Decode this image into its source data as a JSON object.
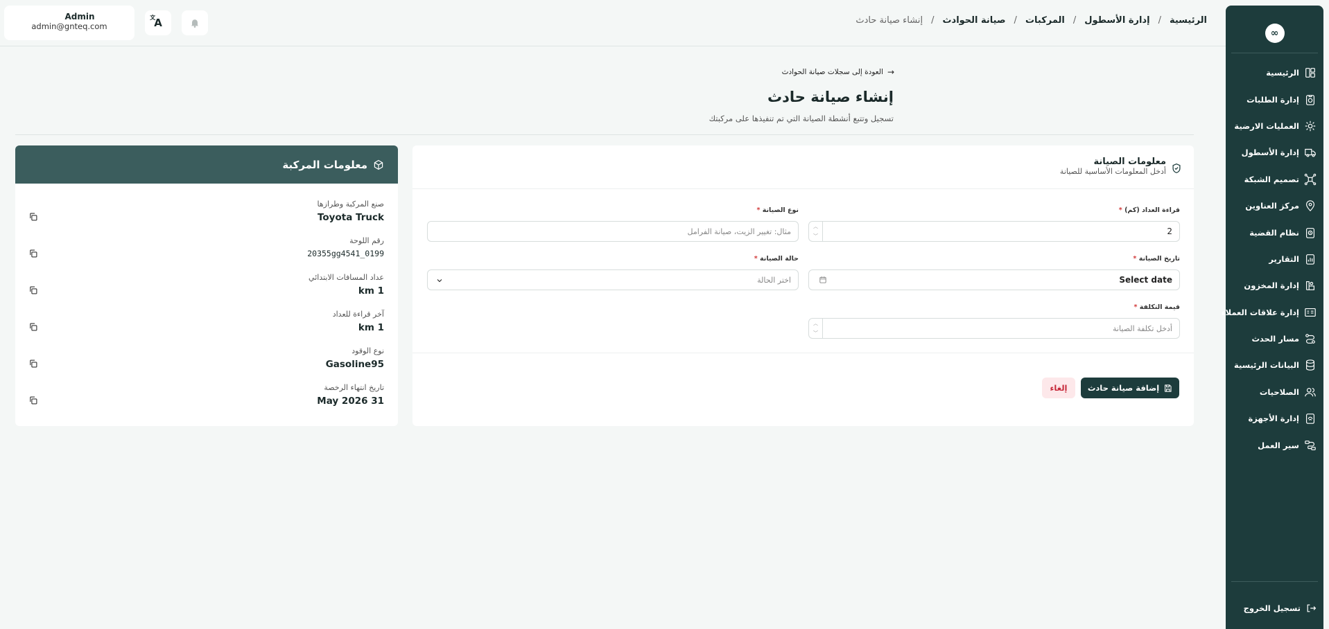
{
  "sidebar": {
    "logo": "∞",
    "items": [
      {
        "label": "الرئيسية",
        "icon": "dashboard-icon"
      },
      {
        "label": "إدارة الطلبات",
        "icon": "orders-icon"
      },
      {
        "label": "العمليات الارضية",
        "icon": "ground-ops-icon"
      },
      {
        "label": "إدارة الأسطول",
        "icon": "truck-icon"
      },
      {
        "label": "تصميم الشبكة",
        "icon": "network-icon"
      },
      {
        "label": "مركز العناوين",
        "icon": "location-pin-icon"
      },
      {
        "label": "نظام القضية",
        "icon": "case-icon"
      },
      {
        "label": "التقارير",
        "icon": "report-icon"
      },
      {
        "label": "إدارة المخزون",
        "icon": "inventory-icon"
      },
      {
        "label": "إدارة علاقات العملاء",
        "icon": "crm-icon"
      },
      {
        "label": "مسار الحدث",
        "icon": "route-icon"
      },
      {
        "label": "البيانات الرئيسية",
        "icon": "database-icon"
      },
      {
        "label": "الصلاحيات",
        "icon": "users-icon"
      },
      {
        "label": "إدارة الأجهزة",
        "icon": "devices-icon"
      },
      {
        "label": "سير العمل",
        "icon": "workflow-icon"
      }
    ],
    "logout": "تسجيل الخروج"
  },
  "topbar": {
    "user_name": "Admin",
    "user_email": "admin@gnteq.com",
    "lang_glyph": "A"
  },
  "breadcrumb": [
    "الرئيسية",
    "إدارة الأسطول",
    "المركبات",
    "صيانة الحوادث",
    "إنشاء صيانة حادث"
  ],
  "page": {
    "back_link": "العودة إلى سجلات صيانة الحوادث",
    "title": "إنشاء صيانة حادث",
    "subtitle": "تسجيل وتتبع أنشطة الصيانة التي تم تنفيذها على مركبتك"
  },
  "form": {
    "title": "معلومات الصيانة",
    "subtitle": "أدخل المعلومات الأساسية للصيانة",
    "odometer_label": "قراءة العداد (كم)",
    "odometer_value": "2",
    "type_label": "نوع الصيانة",
    "type_placeholder": "مثال: تغيير الزيت، صيانة الفرامل",
    "date_label": "تاريخ الصيانة",
    "date_value": "Select date",
    "status_label": "حالة الصيانة",
    "status_placeholder": "اختر الحالة",
    "cost_label": "قيمة التكلفة",
    "cost_placeholder": "أدخل تكلفة الصيانة",
    "submit_label": "إضافة صيانة حادث",
    "cancel_label": "إلغاء"
  },
  "vehicle": {
    "title": "معلومات المركبة",
    "fields": [
      {
        "label": "صنع المركبة وطرازها",
        "value": "Toyota Truck"
      },
      {
        "label": "رقم اللوحة",
        "value": "20355gg4541_0199"
      },
      {
        "label": "عداد المسافات الابتدائي",
        "value": "1 km"
      },
      {
        "label": "آخر قراءة للعداد",
        "value": "1 km"
      },
      {
        "label": "نوع الوقود",
        "value": "Gasoline95"
      },
      {
        "label": "تاريخ انتهاء الرخصة",
        "value": "31 May 2026"
      }
    ]
  }
}
